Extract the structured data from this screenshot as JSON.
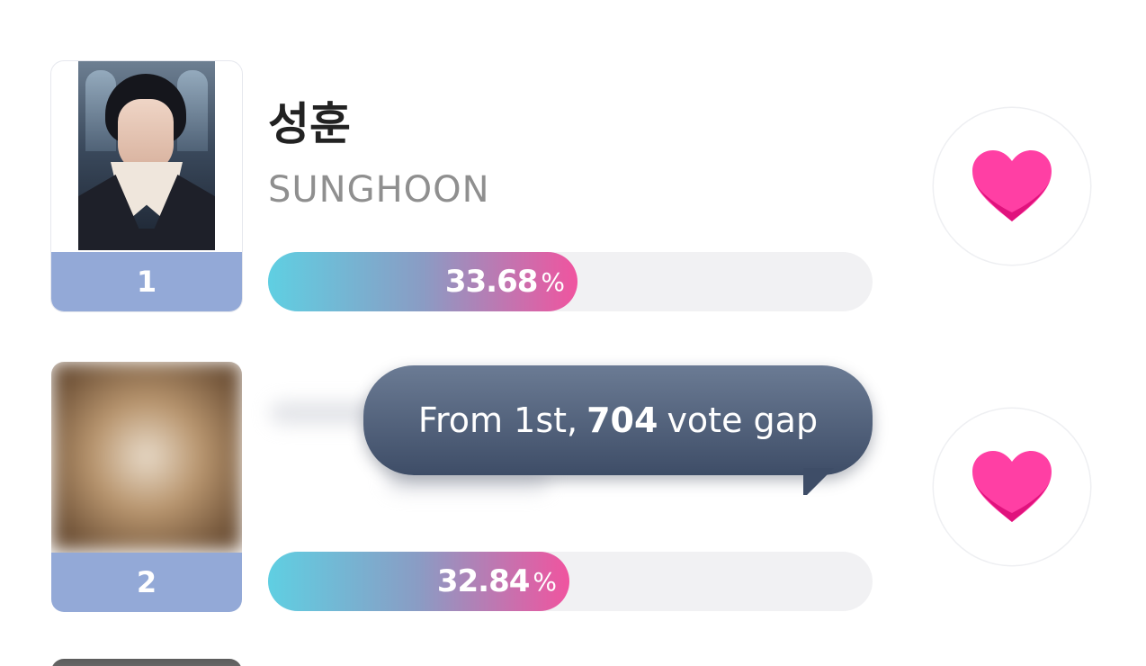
{
  "colors": {
    "rank_badge": "#93a9d7",
    "bar_gradient_start": "#5fcfe2",
    "bar_gradient_end": "#f0549f",
    "heart": "#ff3fa4",
    "tooltip_bg": "#4f5e78"
  },
  "entries": [
    {
      "rank": "1",
      "name_korean": "성훈",
      "name_english": "SUNGHOON",
      "percent": "33.68",
      "percent_unit": "%",
      "vote_icon": "heart-icon"
    },
    {
      "rank": "2",
      "percent": "32.84",
      "percent_unit": "%",
      "vote_icon": "heart-icon"
    }
  ],
  "tooltip": {
    "prefix": "From 1st,",
    "gap_value": "704",
    "suffix": "vote gap"
  }
}
